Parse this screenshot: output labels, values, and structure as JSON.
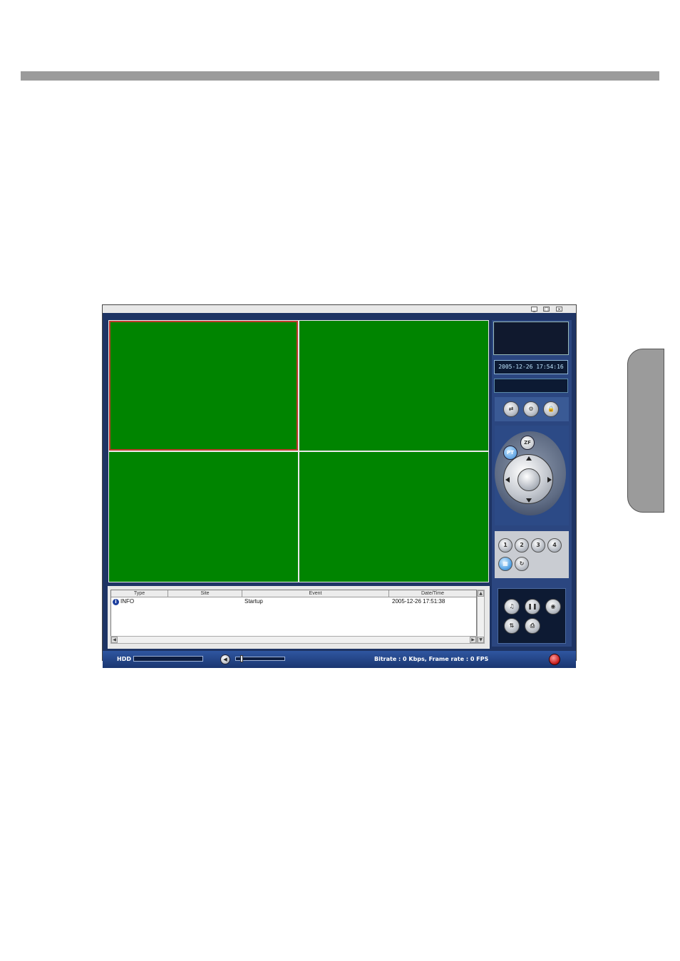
{
  "window": {
    "controls": [
      "_",
      "□",
      "×"
    ]
  },
  "event_log": {
    "columns": [
      "Type",
      "Site",
      "Event",
      "Date/Time"
    ],
    "rows": [
      {
        "type": "INFO",
        "site": "",
        "event": "Startup",
        "datetime": "2005-12-26 17:51:38"
      }
    ]
  },
  "panel": {
    "datetime": "2005-12-26 17:54:16",
    "ptz": {
      "pt_label": "PT",
      "zf_label": "ZF"
    },
    "channels": [
      "1",
      "2",
      "3",
      "4"
    ]
  },
  "status_bar": {
    "hdd_label": "HDD",
    "bitrate_text": "Bitrate : 0 Kbps, Frame rate : 0 FPS"
  },
  "colors": {
    "video_background": "#008400",
    "selected_border": "#c0392b",
    "panel_blue": "#1e3464"
  }
}
